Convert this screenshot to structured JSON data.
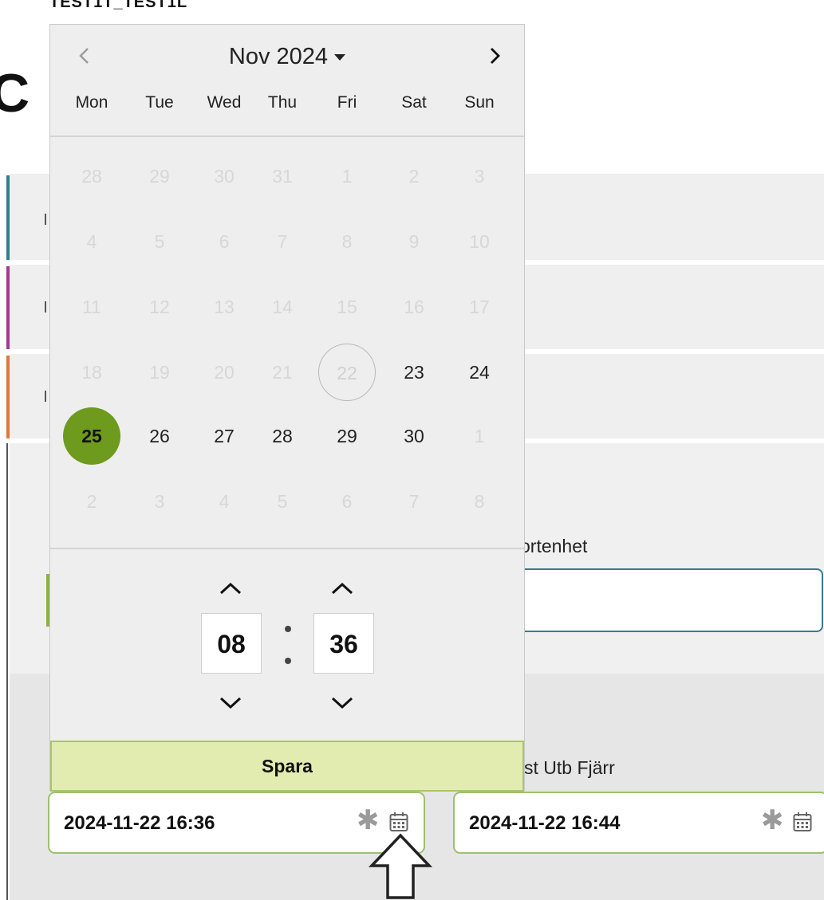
{
  "header": {
    "top_label": "TEST1T_TEST1L",
    "big_letter": "C"
  },
  "labels": {
    "transport_unit_partial": "ortenhet",
    "dest_partial": "st Utb Fjärr"
  },
  "fields": {
    "date_left": "2024-11-22 16:36",
    "date_right": "2024-11-22 16:44"
  },
  "datepicker": {
    "month_label": "Nov 2024",
    "weekdays": [
      "Mon",
      "Tue",
      "Wed",
      "Thu",
      "Fri",
      "Sat",
      "Sun"
    ],
    "weeks": [
      [
        {
          "d": "28",
          "s": "muted"
        },
        {
          "d": "29",
          "s": "muted"
        },
        {
          "d": "30",
          "s": "muted"
        },
        {
          "d": "31",
          "s": "muted"
        },
        {
          "d": "1",
          "s": "muted"
        },
        {
          "d": "2",
          "s": "muted"
        },
        {
          "d": "3",
          "s": "muted"
        }
      ],
      [
        {
          "d": "4",
          "s": "muted"
        },
        {
          "d": "5",
          "s": "muted"
        },
        {
          "d": "6",
          "s": "muted"
        },
        {
          "d": "7",
          "s": "muted"
        },
        {
          "d": "8",
          "s": "muted"
        },
        {
          "d": "9",
          "s": "muted"
        },
        {
          "d": "10",
          "s": "muted"
        }
      ],
      [
        {
          "d": "11",
          "s": "muted"
        },
        {
          "d": "12",
          "s": "muted"
        },
        {
          "d": "13",
          "s": "muted"
        },
        {
          "d": "14",
          "s": "muted"
        },
        {
          "d": "15",
          "s": "muted"
        },
        {
          "d": "16",
          "s": "muted"
        },
        {
          "d": "17",
          "s": "muted"
        }
      ],
      [
        {
          "d": "18",
          "s": "muted"
        },
        {
          "d": "19",
          "s": "muted"
        },
        {
          "d": "20",
          "s": "muted"
        },
        {
          "d": "21",
          "s": "muted"
        },
        {
          "d": "22",
          "s": "today"
        },
        {
          "d": "23",
          "s": "normal"
        },
        {
          "d": "24",
          "s": "normal"
        }
      ],
      [
        {
          "d": "25",
          "s": "selected"
        },
        {
          "d": "26",
          "s": "normal"
        },
        {
          "d": "27",
          "s": "normal"
        },
        {
          "d": "28",
          "s": "normal"
        },
        {
          "d": "29",
          "s": "normal"
        },
        {
          "d": "30",
          "s": "normal"
        },
        {
          "d": "1",
          "s": "muted"
        }
      ],
      [
        {
          "d": "2",
          "s": "muted"
        },
        {
          "d": "3",
          "s": "muted"
        },
        {
          "d": "4",
          "s": "muted"
        },
        {
          "d": "5",
          "s": "muted"
        },
        {
          "d": "6",
          "s": "muted"
        },
        {
          "d": "7",
          "s": "muted"
        },
        {
          "d": "8",
          "s": "muted"
        }
      ]
    ],
    "hour": "08",
    "minute": "36",
    "save_label": "Spara"
  },
  "colors": {
    "selected_day": "#6e9a1e",
    "save_button_bg": "#e2ecb0",
    "side_bars": [
      "#2f7f8c",
      "#a23b8f",
      "#e0773a"
    ]
  },
  "icons": {
    "prev": "chevron-left-icon",
    "next": "chevron-right-icon",
    "month_dropdown": "caret-down-icon",
    "hour_up": "chevron-up-icon",
    "hour_down": "chevron-down-icon",
    "field_required": "asterisk-icon",
    "field_calendar": "calendar-icon",
    "pointer": "arrow-up-outline-icon"
  }
}
